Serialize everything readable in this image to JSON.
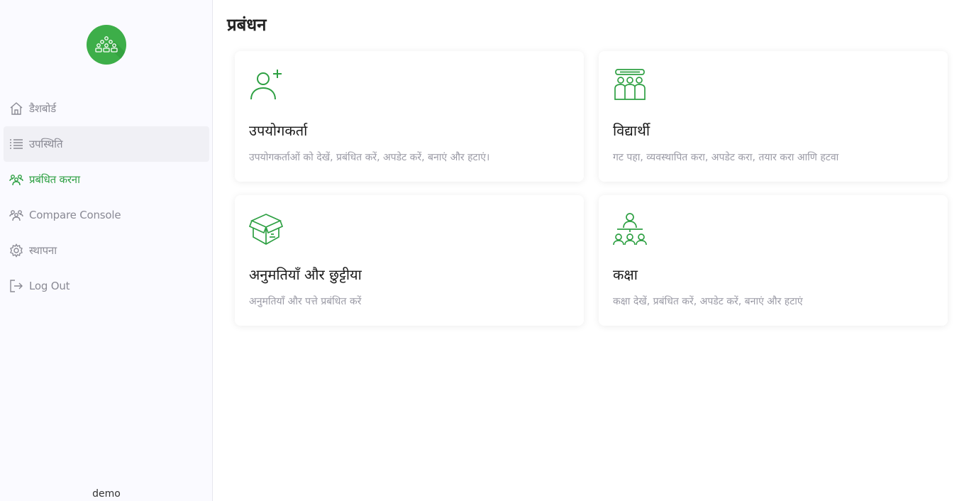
{
  "sidebar": {
    "items": [
      {
        "label": "डैशबोर्ड",
        "icon": "home-icon"
      },
      {
        "label": "उपस्थिति",
        "icon": "list-icon"
      },
      {
        "label": "प्रबंधित करना",
        "icon": "users-icon"
      },
      {
        "label": "Compare Console",
        "icon": "users-icon"
      },
      {
        "label": "स्थापना",
        "icon": "gear-icon"
      },
      {
        "label": "Log Out",
        "icon": "logout-icon"
      }
    ],
    "user": "demo",
    "logo_icon": "group-icon"
  },
  "main": {
    "title": "प्रबंधन",
    "cards": [
      {
        "title": "उपयोगकर्ता",
        "description": "उपयोगकर्ताओं को देखें, प्रबंधित करें, अपडेट करें, बनाएं और हटाएं।",
        "icon": "user-plus-icon"
      },
      {
        "title": "विद्यार्थी",
        "description": "गट पहा, व्यवस्थापित करा, अपडेट करा, तयार करा आणि हटवा",
        "icon": "students-icon"
      },
      {
        "title": "अनुमतियाँ और छुट्टीया",
        "description": "अनुमतियाँ और पत्ते प्रबंधित करें",
        "icon": "box-icon"
      },
      {
        "title": "कक्षा",
        "description": "कक्षा देखें, प्रबंधित करें, अपडेट करें, बनाएं और हटाएं",
        "icon": "classroom-icon"
      }
    ]
  },
  "colors": {
    "accent": "#2ea043",
    "logo_bg": "#3dae49",
    "sidebar_bg": "#fafaff",
    "muted_text": "#9a9aa5"
  }
}
